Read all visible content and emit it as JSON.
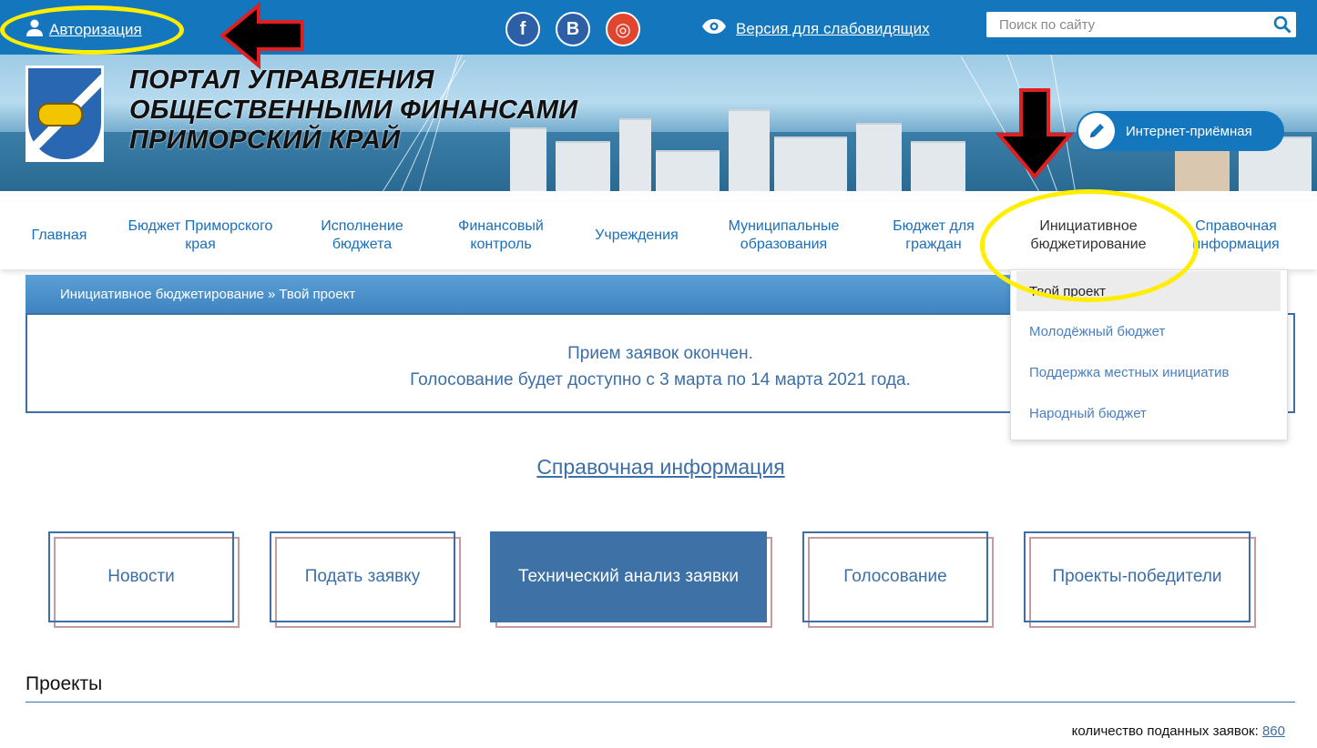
{
  "topbar": {
    "auth_label": "Авторизация",
    "vision_label": "Версия для слабовидящих",
    "search_placeholder": "Поиск по сайту",
    "social": [
      {
        "icon": "facebook-icon",
        "glyph": "f"
      },
      {
        "icon": "vk-icon",
        "glyph": "В"
      },
      {
        "icon": "instagram-icon",
        "glyph": "◎"
      }
    ]
  },
  "header": {
    "title_lines": [
      "ПОРТАЛ УПРАВЛЕНИЯ",
      "ОБЩЕСТВЕННЫМИ ФИНАНСАМИ",
      "ПРИМОРСКИЙ КРАЙ"
    ],
    "reception_label": "Интернет-приёмная"
  },
  "nav": {
    "items": [
      {
        "label": "Главная"
      },
      {
        "label": "Бюджет Приморского края"
      },
      {
        "label": "Исполнение бюджета"
      },
      {
        "label": "Финансовый контроль"
      },
      {
        "label": "Учреждения"
      },
      {
        "label": "Муниципальные образования"
      },
      {
        "label": "Бюджет для граждан"
      },
      {
        "label": "Инициативное бюджетирование"
      },
      {
        "label": "Справочная информация"
      }
    ],
    "active_index": 7
  },
  "dropdown": {
    "items": [
      {
        "label": "Твой проект"
      },
      {
        "label": "Молодёжный бюджет"
      },
      {
        "label": "Поддержка местных инициатив"
      },
      {
        "label": "Народный бюджет"
      }
    ]
  },
  "breadcrumb": {
    "items": [
      "Инициативное бюджетирование",
      "Твой проект"
    ],
    "separator": "»"
  },
  "notice": {
    "line1": "Прием заявок окончен.",
    "line2": "Голосование будет доступно с 3 марта по 14 марта 2021 года."
  },
  "reference_link": "Справочная информация",
  "tiles": [
    {
      "label": "Новости"
    },
    {
      "label": "Подать заявку"
    },
    {
      "label": "Технический анализ заявки"
    },
    {
      "label": "Голосование"
    },
    {
      "label": "Проекты-победители"
    }
  ],
  "projects": {
    "heading": "Проекты",
    "count_label": "количество поданных заявок:",
    "count_value": "860"
  },
  "colors": {
    "brand_blue": "#1476bd",
    "text_blue": "#3c6fa6",
    "annotation_yellow": "#ffee00",
    "annotation_red": "#e02020"
  }
}
